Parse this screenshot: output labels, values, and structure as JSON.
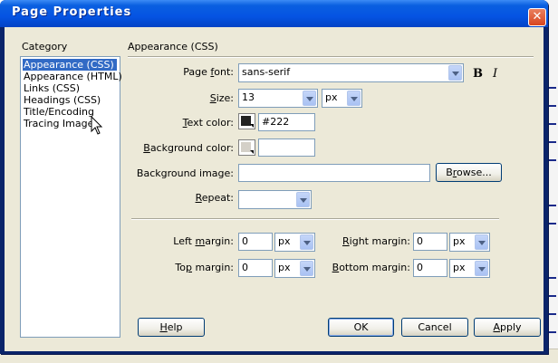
{
  "dialog": {
    "title": "Page Properties",
    "close_glyph": "✕"
  },
  "category": {
    "label": "Category",
    "items": [
      {
        "label": "Appearance (CSS)",
        "selected": true
      },
      {
        "label": "Appearance (HTML)",
        "selected": false
      },
      {
        "label": "Links (CSS)",
        "selected": false
      },
      {
        "label": "Headings (CSS)",
        "selected": false
      },
      {
        "label": "Title/Encoding",
        "selected": false
      },
      {
        "label": "Tracing Image",
        "selected": false
      }
    ]
  },
  "section": {
    "title": "Appearance (CSS)"
  },
  "page_font": {
    "label_pre": "Page ",
    "label_key": "f",
    "label_post": "ont:",
    "value": "sans-serif",
    "bold_glyph": "B",
    "italic_glyph": "I"
  },
  "size": {
    "label_key": "S",
    "label_post": "ize:",
    "value": "13",
    "unit": "px"
  },
  "text_color": {
    "label_key": "T",
    "label_post": "ext color:",
    "swatch_color": "#222222",
    "value": "#222"
  },
  "background_color": {
    "label_key": "B",
    "label_post": "ackground color:",
    "swatch_color": "#ffffff",
    "value": ""
  },
  "background_image": {
    "label": "Background image:",
    "value": "",
    "browse_pre": "B",
    "browse_key": "r",
    "browse_post": "owse..."
  },
  "repeat": {
    "label_key": "R",
    "label_post": "epeat:",
    "value": ""
  },
  "margins": {
    "left": {
      "label_pre": "Left ",
      "label_key": "m",
      "label_post": "argin:",
      "value": "0",
      "unit": "px"
    },
    "right": {
      "label_key": "R",
      "label_post": "ight margin:",
      "value": "0",
      "unit": "px"
    },
    "top": {
      "label_pre": "To",
      "label_key": "p",
      "label_post": " margin:",
      "value": "0",
      "unit": "px"
    },
    "bottom": {
      "label_key": "B",
      "label_post": "ottom margin:",
      "value": "0",
      "unit": "px"
    }
  },
  "buttons": {
    "help_key": "H",
    "help_post": "elp",
    "ok": "OK",
    "cancel": "Cancel",
    "apply_key": "A",
    "apply_post": "pply"
  },
  "colors": {
    "titlebar": "#0554e3",
    "selection": "#316ac5",
    "dialog_face": "#ece9d8"
  }
}
